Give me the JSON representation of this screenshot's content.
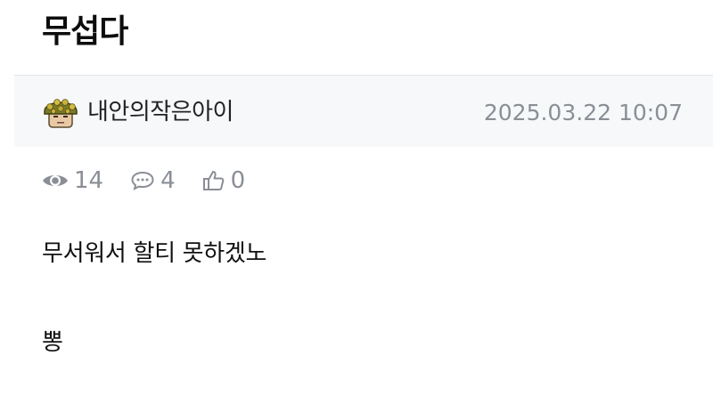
{
  "post": {
    "title": "무섭다",
    "author": {
      "nickname": "내안의작은아이",
      "avatar_icon": "helmet-soldier-avatar-icon"
    },
    "date": "2025.03.22 10:07",
    "stats": {
      "views": "14",
      "comments": "4",
      "likes": "0",
      "views_icon": "eye-icon",
      "comments_icon": "speech-bubble-icon",
      "likes_icon": "thumbs-up-icon"
    },
    "content": {
      "line1": "무서워서 할티 못하겠노",
      "line2": "뽕"
    }
  },
  "colors": {
    "meta_background": "#f7f8fa",
    "muted_text": "#8a8f96",
    "primary_text": "#111111"
  }
}
